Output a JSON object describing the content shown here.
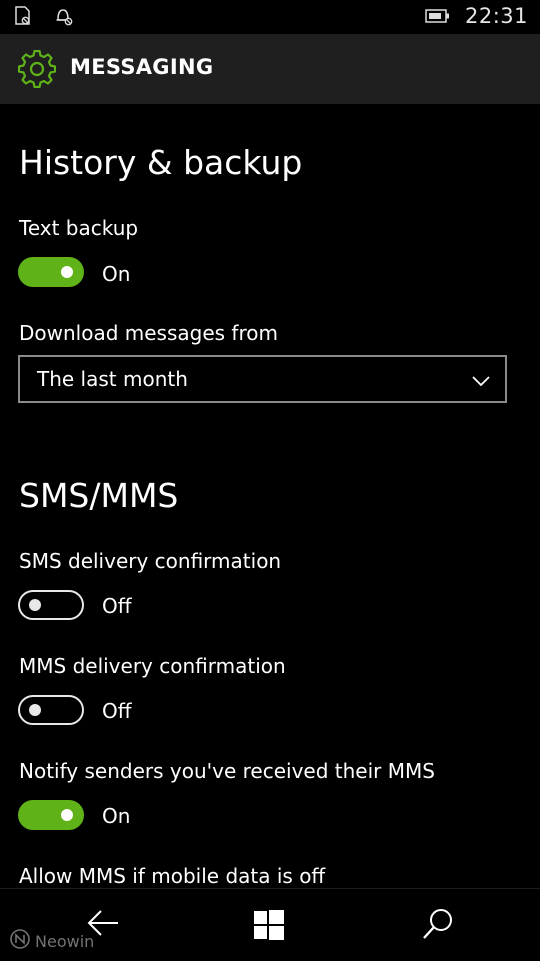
{
  "status_bar": {
    "time": "22:31",
    "icons": [
      "sim-nosignal-icon",
      "alarm-off-icon",
      "battery-icon"
    ]
  },
  "header": {
    "title": "MESSAGING",
    "icon": "gear-icon"
  },
  "history_backup": {
    "title": "History & backup",
    "text_backup": {
      "label": "Text backup",
      "state": "On",
      "on": true
    },
    "download": {
      "label": "Download messages from",
      "value": "The last month"
    }
  },
  "sms_mms": {
    "title": "SMS/MMS",
    "settings": [
      {
        "label": "SMS delivery confirmation",
        "state": "Off",
        "on": false
      },
      {
        "label": "MMS delivery confirmation",
        "state": "Off",
        "on": false
      },
      {
        "label": "Notify senders you've received their MMS",
        "state": "On",
        "on": true
      }
    ],
    "partial_label": "Allow MMS if mobile data is off"
  },
  "nav": {
    "back": "back-arrow-icon",
    "start": "windows-logo-icon",
    "search": "search-icon",
    "watermark": "Neowin"
  },
  "colors": {
    "accent": "#5fb319",
    "background": "#000000",
    "header": "#1f1f1f"
  }
}
